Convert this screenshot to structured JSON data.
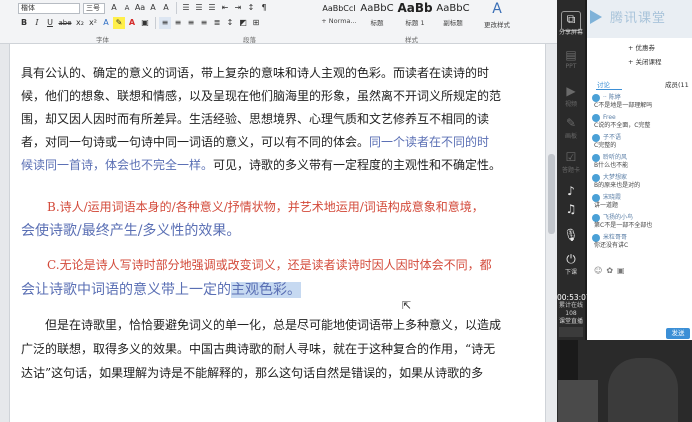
{
  "ribbon": {
    "font_name": "楷体",
    "font_size": "三号",
    "row1_buttons": [
      "A",
      "A",
      "Aa",
      "A",
      "A"
    ],
    "row2_buttons": [
      "B",
      "I",
      "U",
      "abe",
      "x₂",
      "x²",
      "A",
      "A"
    ],
    "groups": {
      "font": "字体",
      "paragraph": "段落",
      "styles": "样式"
    },
    "styles": [
      {
        "preview": "AaBbCcI",
        "name": "+ Norma..."
      },
      {
        "preview": "AaBbC",
        "name": "标题"
      },
      {
        "preview": "AaBb",
        "name": "标题 1"
      },
      {
        "preview": "AaBbC",
        "name": "副标题"
      }
    ],
    "change_style": "更改样式"
  },
  "document": {
    "lines": [
      "具有公认的、确定的意义的词语，带上复杂的意味和诗人主观的色彩。而读者在读诗的时",
      "候，他们的想象、联想和情感，以及呈现在他们脑海里的形象，虽然离不开词义所规定的范",
      "围，却又因人因时而有所差异。生活经验、思想境界、心理气质和文艺修养互不相同的读",
      "者，对同一句诗或一句诗中同一词语的意义，可以有不同的体会。"
    ],
    "line4_blue": "同一个读者在不同的时",
    "line5_blue": "候读同一首诗，体会也不完全一样。",
    "line5_black": "可见，诗歌的多义带有一定程度的主观性和不确定性。",
    "point_b_red": "B.诗人/运用词语本身的/各种意义/抒情状物，并艺术地运用/词语构成意象和意境，",
    "point_b_blue": "会使诗歌/最终产生/多义性的效果。",
    "point_c_red": "C.无论是诗人写诗时部分地强调或改变词义，还是读者读诗时因人因时体会不同，都",
    "point_c_blue": "会让诗歌中词语的意义带上一定的",
    "point_c_selected": "主观色彩。",
    "para2": [
      "但是在诗歌里，恰恰要避免词义的单一化，总是尽可能地使词语带上多种意义，以造成",
      "广泛的联想，取得多义的效果。中国古典诗歌的耐人寻味，就在于这种复合的作用，“诗无",
      "达诂”这句话，如果理解为诗是不能解释的，那么这句话自然是错误的，如果从诗歌的多"
    ]
  },
  "panel": {
    "logo": "腾讯课堂",
    "side": [
      "分享屏幕",
      "PPT",
      "视频",
      "画板",
      "答题卡"
    ],
    "side_bottom": [
      "下课"
    ],
    "timer_time": "00:53:07",
    "timer_label": "累计在线",
    "timer_sub": "108",
    "timer_extra": "课堂直播",
    "menu": [
      "+ 优惠券",
      "+ 关闭课程"
    ],
    "tabs": {
      "discussion": "讨论",
      "members": "成员(11"
    },
    "chat": [
      {
        "user": "·· 陈婷",
        "msg": "C不是地是一部理解吗"
      },
      {
        "user": "Free",
        "msg": "C说的不全面，C完整"
      },
      {
        "user": "子不语",
        "msg": "C完整的"
      },
      {
        "user": "聆听的风",
        "msg": "B什么也不能"
      },
      {
        "user": "大梦想家",
        "msg": "B的原来也是对的"
      },
      {
        "user": "宋晓霞",
        "msg": "讲一道题"
      },
      {
        "user": "飞扬的小鸟",
        "msg": "第C不是一部不全部也"
      },
      {
        "user": "米粒哥哥",
        "msg": "你还没有讲C"
      }
    ],
    "send": "发送"
  }
}
